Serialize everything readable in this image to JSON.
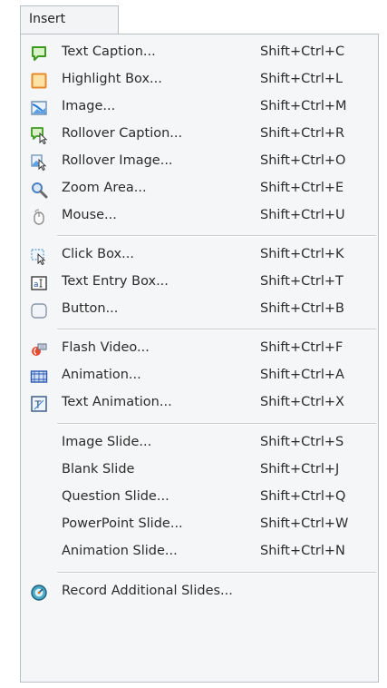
{
  "menu": {
    "title": "Insert",
    "items": [
      {
        "label": "Text Caption...",
        "shortcut": "Shift+Ctrl+C",
        "icon": "text-caption-icon"
      },
      {
        "label": "Highlight Box...",
        "shortcut": "Shift+Ctrl+L",
        "icon": "highlight-box-icon"
      },
      {
        "label": "Image...",
        "shortcut": "Shift+Ctrl+M",
        "icon": "image-icon"
      },
      {
        "label": "Rollover Caption...",
        "shortcut": "Shift+Ctrl+R",
        "icon": "rollover-caption-icon"
      },
      {
        "label": "Rollover Image...",
        "shortcut": "Shift+Ctrl+O",
        "icon": "rollover-image-icon"
      },
      {
        "label": "Zoom Area...",
        "shortcut": "Shift+Ctrl+E",
        "icon": "zoom-area-icon"
      },
      {
        "label": "Mouse...",
        "shortcut": "Shift+Ctrl+U",
        "icon": "mouse-icon"
      },
      {
        "label": "Click Box...",
        "shortcut": "Shift+Ctrl+K",
        "icon": "click-box-icon"
      },
      {
        "label": "Text Entry Box...",
        "shortcut": "Shift+Ctrl+T",
        "icon": "text-entry-box-icon"
      },
      {
        "label": "Button...",
        "shortcut": "Shift+Ctrl+B",
        "icon": "button-icon"
      },
      {
        "label": "Flash Video...",
        "shortcut": "Shift+Ctrl+F",
        "icon": "flash-video-icon"
      },
      {
        "label": "Animation...",
        "shortcut": "Shift+Ctrl+A",
        "icon": "animation-icon"
      },
      {
        "label": "Text Animation...",
        "shortcut": "Shift+Ctrl+X",
        "icon": "text-animation-icon"
      },
      {
        "label": "Image Slide...",
        "shortcut": "Shift+Ctrl+S"
      },
      {
        "label": "Blank Slide",
        "shortcut": "Shift+Ctrl+J"
      },
      {
        "label": "Question Slide...",
        "shortcut": "Shift+Ctrl+Q"
      },
      {
        "label": "PowerPoint Slide...",
        "shortcut": "Shift+Ctrl+W"
      },
      {
        "label": "Animation Slide...",
        "shortcut": "Shift+Ctrl+N"
      },
      {
        "label": "Record Additional Slides...",
        "icon": "record-icon"
      }
    ]
  },
  "colors": {
    "menu_background": "#f5f6f7",
    "border": "#b9bdc4",
    "separator": "#c9ccd1",
    "text": "#2b2b2b"
  }
}
